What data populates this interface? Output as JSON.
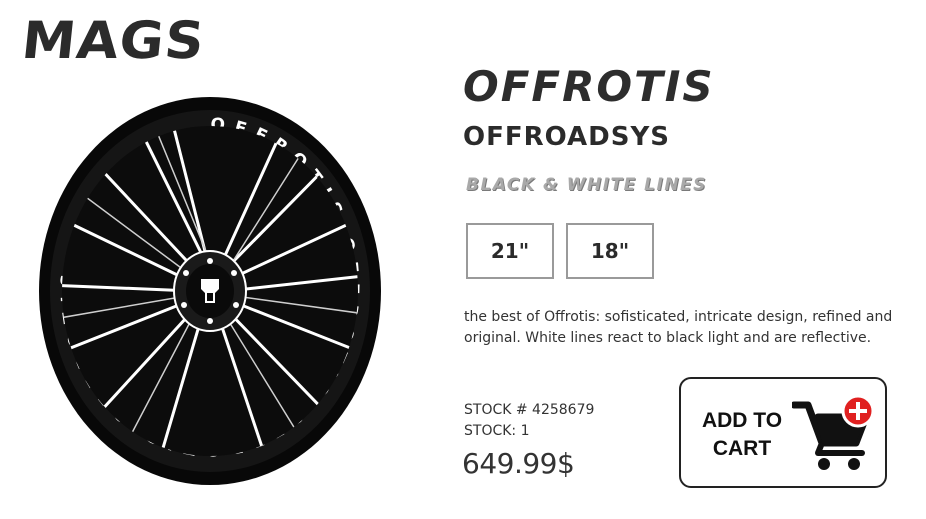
{
  "header": {
    "logo_text": "MAGS"
  },
  "product": {
    "name": "OFFROTIS",
    "brand": "OFFROADSYS",
    "finish": "BLACK & WHITE LINES",
    "sizes": [
      {
        "label": "21\""
      },
      {
        "label": "18\""
      }
    ],
    "description": "the best of Offrotis: sofisticated, intricate design, refined and original. White lines react to black light and are reflective.",
    "stock_number": "STOCK # 4258679",
    "stock_count": "STOCK: 1",
    "price": "649.99$",
    "wheel_lip_text": "OFFROTIS OFFROTIS OFFROTIS OFFROTIS",
    "center_cap_icon": "tire-logo-icon"
  },
  "cart": {
    "label_line1": "ADD TO",
    "label_line2": "CART",
    "icon": "cart-plus-icon",
    "accent_color": "#e02020"
  }
}
